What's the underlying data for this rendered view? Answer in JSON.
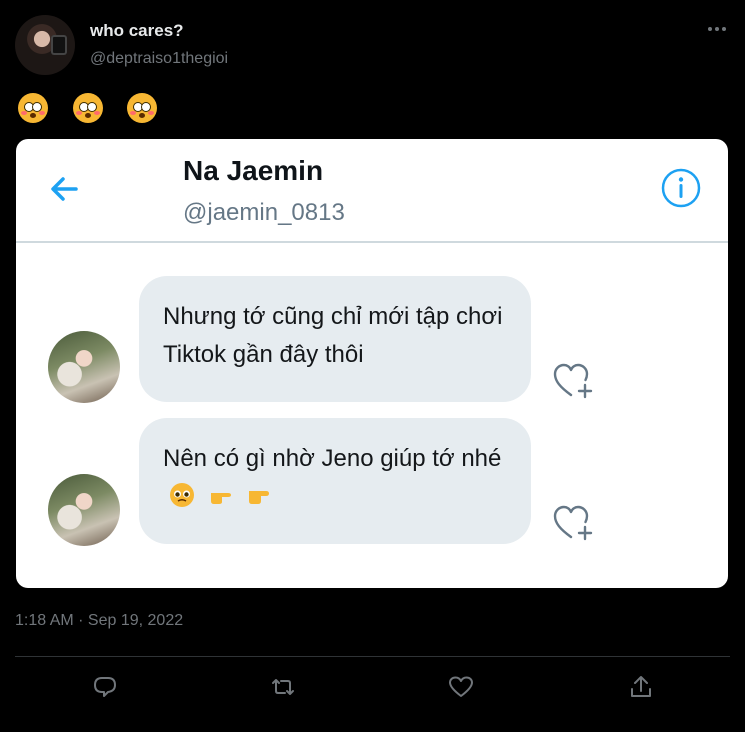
{
  "tweet": {
    "author": {
      "display_name": "who cares?",
      "handle": "@deptraiso1thegioi",
      "avatar_icon": "avatar-photo"
    },
    "more_icon": "more-horizontal-icon",
    "emojis": [
      "flushed-face",
      "flushed-face",
      "flushed-face"
    ],
    "timestamp": "1:18 AM · Sep 19, 2022",
    "actions": [
      {
        "name": "reply",
        "icon": "comment-icon"
      },
      {
        "name": "retweet",
        "icon": "retweet-icon"
      },
      {
        "name": "like",
        "icon": "heart-icon"
      },
      {
        "name": "share",
        "icon": "share-icon"
      }
    ]
  },
  "screenshot": {
    "chat_name": "Na Jaemin",
    "chat_handle": "@jaemin_0813",
    "accent": "#1da1f2",
    "messages": [
      {
        "text": "Nhưng tớ cũng chỉ mới tập chơi Tiktok gần đây thôi",
        "emojis": []
      },
      {
        "text": "Nên có gì nhờ Jeno giúp tớ nhé",
        "emojis": [
          "pleading-face",
          "backhand-index-pointing-right",
          "backhand-index-pointing-right"
        ]
      }
    ]
  },
  "colors": {
    "background": "#000000",
    "text_primary": "#e7e9ea",
    "text_secondary": "#71767b",
    "card_background": "#ffffff",
    "bubble": "#e6ecf0"
  }
}
